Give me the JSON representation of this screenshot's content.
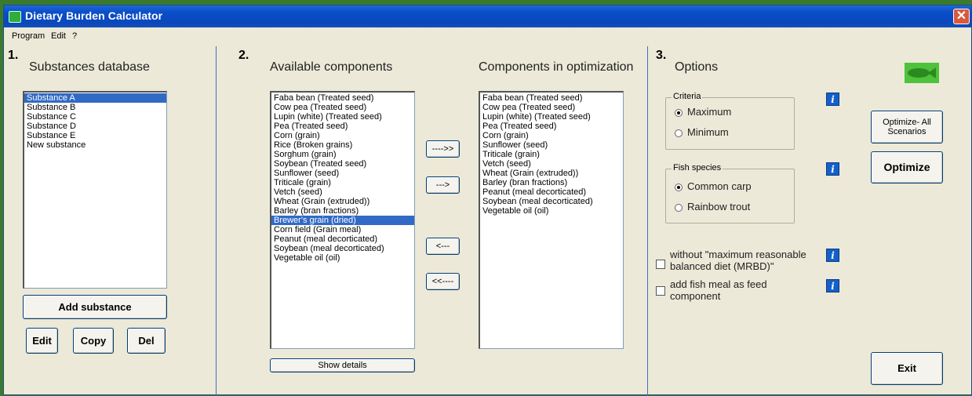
{
  "window": {
    "title": "Dietary Burden Calculator",
    "close_glyph": "✕"
  },
  "menu": [
    "Program",
    "Edit",
    "?"
  ],
  "section1": {
    "number": "1.",
    "heading": "Substances database",
    "substances": [
      "Substance A",
      "Substance B",
      "Substance C",
      "Substance D",
      "Substance E",
      "New substance"
    ],
    "selected_index": 0,
    "add_label": "Add substance",
    "edit_label": "Edit",
    "copy_label": "Copy",
    "del_label": "Del"
  },
  "section2": {
    "number": "2.",
    "available_heading": "Available components",
    "optimization_heading": "Components in optimization",
    "available": [
      "Faba bean (Treated seed)",
      "Cow pea (Treated seed)",
      "Lupin (white) (Treated seed)",
      "Pea (Treated seed)",
      "Corn (grain)",
      "Rice (Broken grains)",
      "Sorghum (grain)",
      "Soybean (Treated seed)",
      "Sunflower (seed)",
      "Triticale (grain)",
      "Vetch (seed)",
      "Wheat (Grain (extruded))",
      "Barley (bran fractions)",
      "Brewer's grain (dried)",
      "Corn field (Grain meal)",
      "Peanut (meal decorticated)",
      "Soybean (meal decorticated)",
      "Vegetable oil (oil)"
    ],
    "available_selected_index": 13,
    "in_optimization": [
      "Faba bean (Treated seed)",
      "Cow pea (Treated seed)",
      "Lupin (white) (Treated seed)",
      "Pea (Treated seed)",
      "Corn (grain)",
      "Sunflower (seed)",
      "Triticale (grain)",
      "Vetch (seed)",
      "Wheat (Grain (extruded))",
      "Barley (bran fractions)",
      "Peanut (meal decorticated)",
      "Soybean (meal decorticated)",
      "Vegetable oil (oil)"
    ],
    "move_all_right": "---->>",
    "move_right": "--->",
    "move_left": "<---",
    "move_all_left": "<<----",
    "show_details": "Show details"
  },
  "section3": {
    "number": "3.",
    "heading": "Options",
    "criteria_label": "Criteria",
    "criteria_options": [
      "Maximum",
      "Minimum"
    ],
    "criteria_selected": "Maximum",
    "fish_label": "Fish species",
    "fish_options": [
      "Common carp",
      "Rainbow trout"
    ],
    "fish_selected": "Common carp",
    "check_mrbd_line1": "without \"maximum reasonable",
    "check_mrbd_line2": "balanced diet (MRBD)\"",
    "check_mrbd_checked": false,
    "check_fishmeal_line1": "add fish meal as feed",
    "check_fishmeal_line2": "component",
    "check_fishmeal_checked": false,
    "info_glyph": "i",
    "optimize_all_line1": "Optimize- All",
    "optimize_all_line2": "Scenarios",
    "optimize_label": "Optimize",
    "exit_label": "Exit"
  },
  "colors": {
    "selection": "#316ac5",
    "titlebar": "#0a4ec9",
    "logo": "#4ec23a"
  },
  "icons": {
    "app": "fish-app-icon",
    "logo": "fish-logo-icon",
    "info": "info-icon"
  }
}
